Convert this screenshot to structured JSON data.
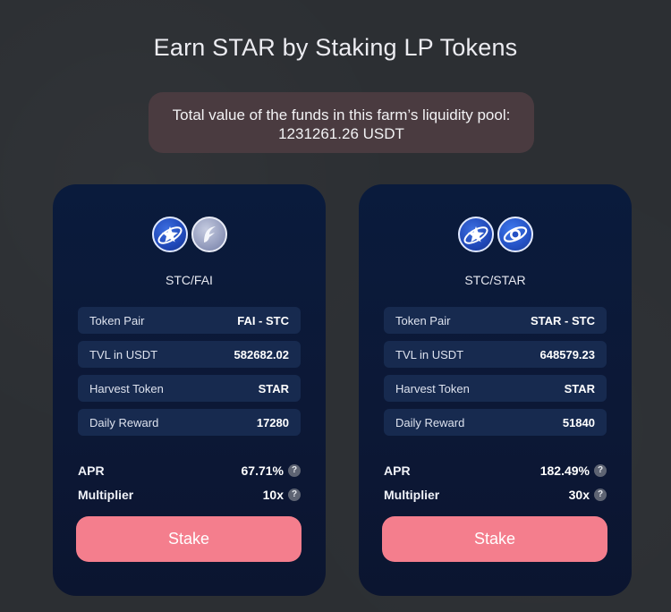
{
  "page": {
    "title": "Earn STAR by Staking LP Tokens"
  },
  "tvl_banner": {
    "line1": "Total value of the funds in this farm’s liquidity pool:",
    "line2": "1231261.26 USDT"
  },
  "farms": [
    {
      "pair_name": "STC/FAI",
      "icons": [
        "stc-coin-icon",
        "fai-coin-icon"
      ],
      "rows": [
        {
          "label": "Token Pair",
          "value": "FAI - STC"
        },
        {
          "label": "TVL in USDT",
          "value": "582682.02"
        },
        {
          "label": "Harvest Token",
          "value": "STAR"
        },
        {
          "label": "Daily Reward",
          "value": "17280"
        }
      ],
      "apr_label": "APR",
      "apr_value": "67.71%",
      "multiplier_label": "Multiplier",
      "multiplier_value": "10x",
      "help": "?",
      "stake_label": "Stake"
    },
    {
      "pair_name": "STC/STAR",
      "icons": [
        "stc-coin-icon",
        "star-coin-icon"
      ],
      "rows": [
        {
          "label": "Token Pair",
          "value": "STAR - STC"
        },
        {
          "label": "TVL in USDT",
          "value": "648579.23"
        },
        {
          "label": "Harvest Token",
          "value": "STAR"
        },
        {
          "label": "Daily Reward",
          "value": "51840"
        }
      ],
      "apr_label": "APR",
      "apr_value": "182.49%",
      "multiplier_label": "Multiplier",
      "multiplier_value": "30x",
      "help": "?",
      "stake_label": "Stake"
    }
  ],
  "colors": {
    "background": "#2c2f33",
    "card": "#0b1834",
    "row": "#172a4f",
    "banner": "#4a3b40",
    "stake_button": "#f47e8d"
  }
}
